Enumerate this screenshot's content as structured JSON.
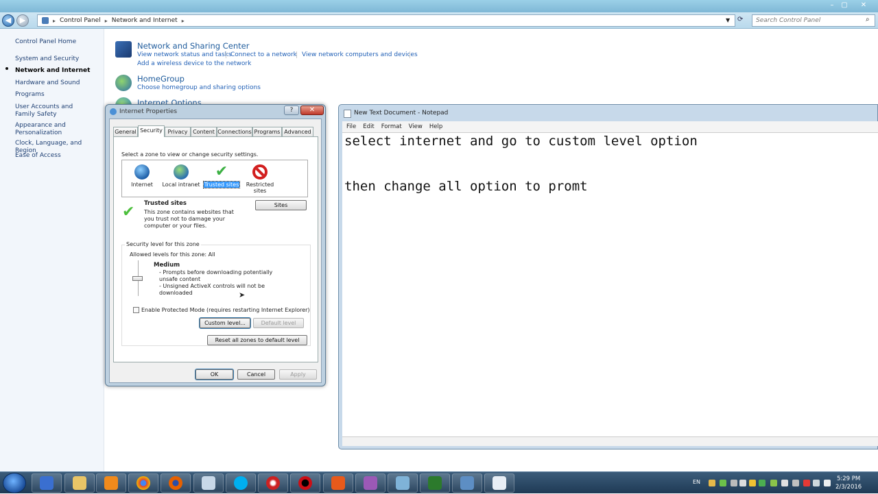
{
  "explorer": {
    "breadcrumb": [
      "Control Panel",
      "Network and Internet"
    ],
    "search_placeholder": "Search Control Panel"
  },
  "left_nav": {
    "home": "Control Panel Home",
    "items": [
      "System and Security",
      "Network and Internet",
      "Hardware and Sound",
      "Programs",
      "User Accounts and Family Safety",
      "Appearance and Personalization",
      "Clock, Language, and Region",
      "Ease of Access"
    ],
    "active": "Network and Internet"
  },
  "categories": [
    {
      "title": "Network and Sharing Center",
      "links": [
        "View network status and tasks",
        "Connect to a network",
        "View network computers and devices",
        "Add a wireless device to the network"
      ]
    },
    {
      "title": "HomeGroup",
      "links": [
        "Choose homegroup and sharing options"
      ]
    },
    {
      "title": "Internet Options",
      "links": []
    }
  ],
  "dialog": {
    "title": "Internet Properties",
    "help": "?",
    "close": "✕",
    "tabs": [
      "General",
      "Security",
      "Privacy",
      "Content",
      "Connections",
      "Programs",
      "Advanced"
    ],
    "selected_tab": "Security",
    "zone_prompt": "Select a zone to view or change security settings.",
    "zones": [
      "Internet",
      "Local intranet",
      "Trusted sites",
      "Restricted sites"
    ],
    "selected_zone": "Trusted sites",
    "zone_heading": "Trusted sites",
    "zone_desc": "This zone contains websites that you trust not to damage your computer or your files.",
    "sites_button": "Sites",
    "security_group": "Security level for this zone",
    "allowed_levels": "Allowed levels for this zone: All",
    "level_name": "Medium",
    "level_bullets": [
      "- Prompts before downloading potentially unsafe content",
      "- Unsigned ActiveX controls will not be downloaded"
    ],
    "protected_mode": "Enable Protected Mode (requires restarting Internet Explorer)",
    "custom_level": "Custom level...",
    "default_level": "Default level",
    "reset_all": "Reset all zones to default level",
    "ok": "OK",
    "cancel": "Cancel",
    "apply": "Apply"
  },
  "notepad": {
    "title": "New Text Document - Notepad",
    "menu": [
      "File",
      "Edit",
      "Format",
      "View",
      "Help"
    ],
    "lines": [
      "select internet and go to custom level option",
      "",
      "then change all option to promt"
    ]
  },
  "taskbar": {
    "language": "EN",
    "time": "5:29 PM",
    "date": "2/3/2016"
  },
  "colors": {
    "link": "#2160b6",
    "selected_zone": "#3399ff"
  }
}
